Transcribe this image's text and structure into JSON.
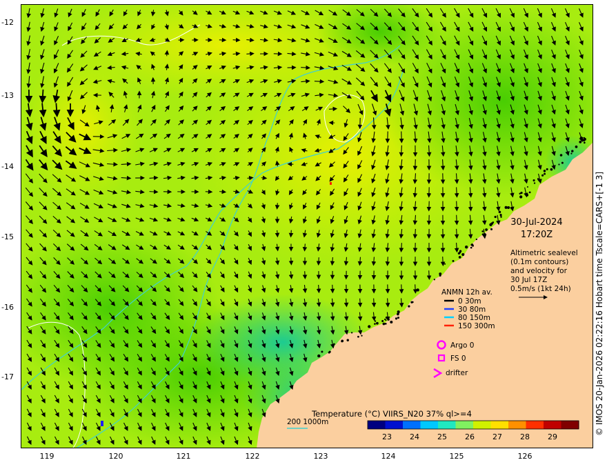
{
  "map": {
    "date": "30-Jul-2024",
    "time": "17:20Z",
    "alt_note": [
      "Altimetric sealevel",
      "(0.1m contours)",
      "and velocity for",
      "30 Jul 17Z",
      "0.5m/s (1kt 24h)"
    ],
    "anmn_title": "ANMN 12h av.",
    "anmn_depths": [
      {
        "label": "0 30m",
        "color": "#000000"
      },
      {
        "label": "30 80m",
        "color": "#2040ff"
      },
      {
        "label": "80 150m",
        "color": "#00d0ff"
      },
      {
        "label": "150 300m",
        "color": "#ff2000"
      }
    ],
    "argo_label": "Argo 0",
    "fs_label": "FS 0",
    "drifter_label": "drifter",
    "marker_color": "#ff00ff",
    "isobath_label": "200  1000m",
    "isobath_color": "#40d0d0",
    "colorbar_title": "Temperature (°C) VIIRS_N20 37% ql>=4",
    "colorbar_ticks": [
      "23",
      "24",
      "25",
      "26",
      "27",
      "28",
      "29"
    ],
    "colorbar_colors": [
      "#000080",
      "#0010d0",
      "#0070ff",
      "#00c8ff",
      "#20e8c0",
      "#80f060",
      "#d0f000",
      "#ffe000",
      "#ff9000",
      "#ff3000",
      "#c00000",
      "#800000"
    ],
    "land_color": "#fbcf9f",
    "credit": "© IMOS 20-Jan-2026 02:22:16 Hobart time Tscale=CARS+[-1 3]",
    "lat_ticks": [
      "-12",
      "-13",
      "-14",
      "-15",
      "-16",
      "-17"
    ],
    "lon_ticks": [
      "119",
      "120",
      "121",
      "122",
      "123",
      "124",
      "125",
      "126"
    ]
  }
}
